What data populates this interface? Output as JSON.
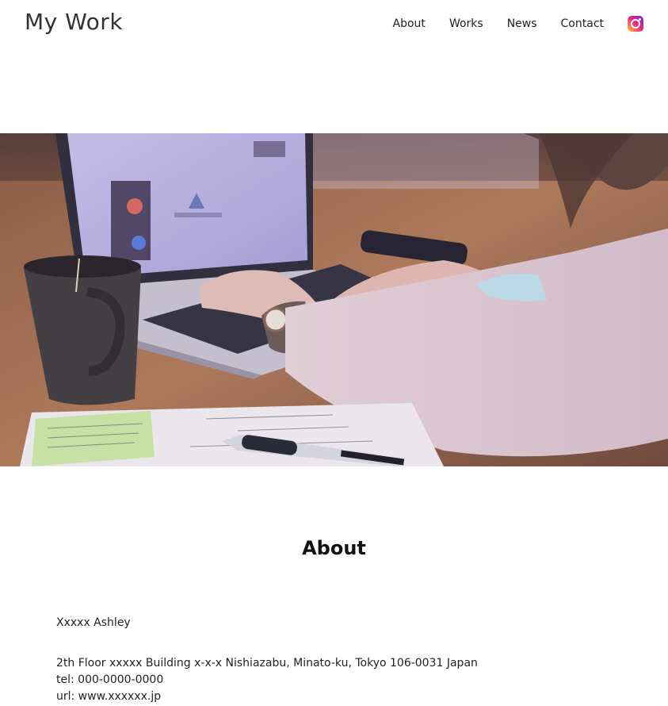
{
  "site": {
    "logo": "My Work"
  },
  "nav": {
    "items": [
      {
        "label": "About"
      },
      {
        "label": "Works"
      },
      {
        "label": "News"
      },
      {
        "label": "Contact"
      }
    ],
    "instagram_icon": "instagram-icon"
  },
  "hero": {
    "image": "photo of person typing on laptop at wooden desk with coffee mug, notes and pen"
  },
  "about": {
    "title": "About",
    "name": "Xxxxx Ashley",
    "address": "2th Floor xxxxx Building x-x-x Nishiazabu, Minato-ku, Tokyo 106-0031 Japan",
    "tel": "tel: 000-0000-0000",
    "url": "url: www.xxxxxx.jp"
  },
  "colors": {
    "text": "#222222",
    "background": "#ffffff"
  }
}
